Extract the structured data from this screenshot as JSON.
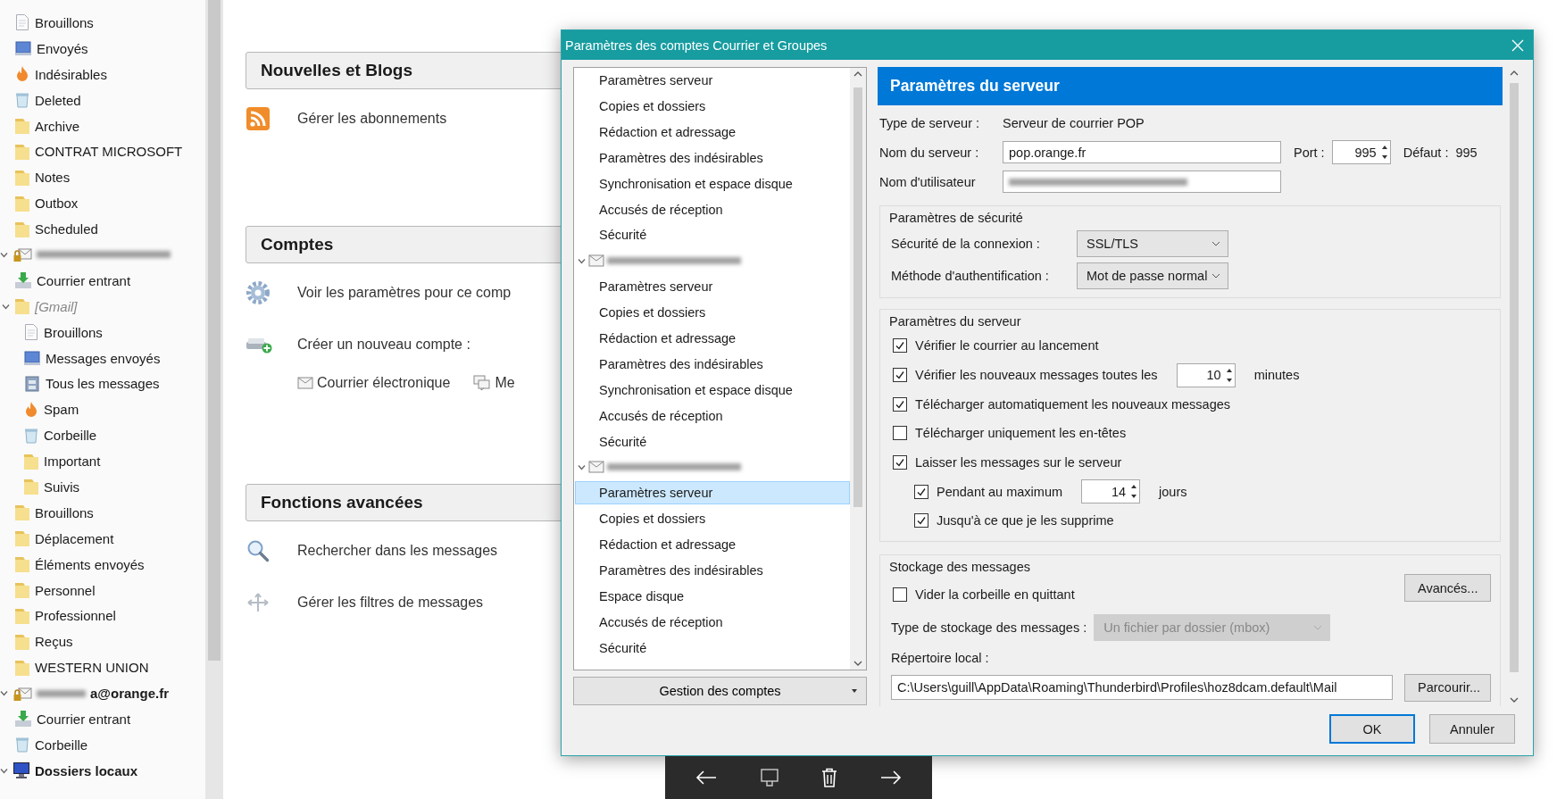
{
  "sidebar": {
    "items": [
      {
        "children": [
          {
            "label": "Brouillons",
            "kind": "drafts"
          },
          {
            "label": "Envoyés",
            "kind": "sent"
          },
          {
            "label": "Indésirables",
            "kind": "junk"
          },
          {
            "label": "Deleted",
            "kind": "trash"
          },
          {
            "label": "Archive",
            "kind": "folder"
          },
          {
            "label": "CONTRAT MICROSOFT",
            "kind": "folder"
          },
          {
            "label": "Notes",
            "kind": "folder"
          },
          {
            "label": "Outbox",
            "kind": "folder"
          },
          {
            "label": "Scheduled",
            "kind": "folder"
          }
        ]
      },
      {
        "kind": "account",
        "redacted": true,
        "expanded": true,
        "children": [
          {
            "label": "Courrier entrant",
            "kind": "inbox"
          },
          {
            "label": "[Gmail]",
            "kind": "virtual",
            "expanded": true,
            "children": [
              {
                "label": "Brouillons",
                "kind": "drafts"
              },
              {
                "label": "Messages envoyés",
                "kind": "sent"
              },
              {
                "label": "Tous les messages",
                "kind": "archive"
              },
              {
                "label": "Spam",
                "kind": "junk"
              },
              {
                "label": "Corbeille",
                "kind": "trash"
              },
              {
                "label": "Important",
                "kind": "folder"
              },
              {
                "label": "Suivis",
                "kind": "folder"
              }
            ]
          },
          {
            "label": "Brouillons",
            "kind": "folder"
          },
          {
            "label": "Déplacement",
            "kind": "folder"
          },
          {
            "label": "Éléments envoyés",
            "kind": "folder"
          },
          {
            "label": "Personnel",
            "kind": "folder"
          },
          {
            "label": "Professionnel",
            "kind": "folder"
          },
          {
            "label": "Reçus",
            "kind": "folder"
          },
          {
            "label": "WESTERN UNION",
            "kind": "folder"
          }
        ]
      },
      {
        "label": "a@orange.fr",
        "kind": "account",
        "redacted": true,
        "expanded": true,
        "children": [
          {
            "label": "Courrier entrant",
            "kind": "inbox"
          },
          {
            "label": "Corbeille",
            "kind": "trash"
          }
        ]
      },
      {
        "label": "Dossiers locaux",
        "kind": "local",
        "redacted": false,
        "expanded": true
      }
    ]
  },
  "main": {
    "sections": [
      {
        "title": "Nouvelles et Blogs",
        "actions": [
          {
            "kind": "rss",
            "label": "Gérer les abonnements"
          }
        ]
      },
      {
        "title": "Comptes",
        "actions": [
          {
            "kind": "gear",
            "label": "Voir les paramètres pour ce comp"
          },
          {
            "kind": "new-account",
            "label": "Créer un nouveau compte :",
            "links": [
              {
                "kind": "envelope",
                "label": "Courrier électronique"
              },
              {
                "kind": "chat",
                "label": "Me"
              }
            ]
          }
        ]
      },
      {
        "title": "Fonctions avancées",
        "actions": [
          {
            "kind": "search",
            "label": "Rechercher dans les messages"
          },
          {
            "kind": "filter",
            "label": "Gérer les filtres de messages"
          }
        ]
      }
    ]
  },
  "dialog": {
    "title": "Paramètres des comptes Courrier et Groupes",
    "tree": [
      {
        "children": [
          {
            "label": "Paramètres serveur",
            "selected": false
          },
          {
            "label": "Copies et dossiers",
            "selected": false
          },
          {
            "label": "Rédaction et adressage",
            "selected": false
          },
          {
            "label": "Paramètres des indésirables",
            "selected": false
          },
          {
            "label": "Synchronisation et espace disque",
            "selected": false
          },
          {
            "label": "Accusés de réception",
            "selected": false
          },
          {
            "label": "Sécurité",
            "selected": false
          }
        ]
      },
      {
        "redacted": true,
        "expanded": true,
        "children": [
          {
            "label": "Paramètres serveur",
            "selected": false
          },
          {
            "label": "Copies et dossiers",
            "selected": false
          },
          {
            "label": "Rédaction et adressage",
            "selected": false
          },
          {
            "label": "Paramètres des indésirables",
            "selected": false
          },
          {
            "label": "Synchronisation et espace disque",
            "selected": false
          },
          {
            "label": "Accusés de réception",
            "selected": false
          },
          {
            "label": "Sécurité",
            "selected": false
          }
        ]
      },
      {
        "redacted": true,
        "expanded": true,
        "children": [
          {
            "label": "Paramètres serveur",
            "selected": true
          },
          {
            "label": "Copies et dossiers",
            "selected": false
          },
          {
            "label": "Rédaction et adressage",
            "selected": false
          },
          {
            "label": "Paramètres des indésirables",
            "selected": false
          },
          {
            "label": "Espace disque",
            "selected": false
          },
          {
            "label": "Accusés de réception",
            "selected": false
          },
          {
            "label": "Sécurité",
            "selected": false
          }
        ]
      }
    ],
    "manage_button": "Gestion des comptes",
    "panel": {
      "title": "Paramètres du serveur",
      "server_type_label": "Type de serveur :",
      "server_type": "Serveur de courrier POP",
      "server_name_label": "Nom du serveur :",
      "server_name": "pop.orange.fr",
      "port_label": "Port :",
      "port": "995",
      "default_label": "Défaut :",
      "default_port": "995",
      "username_label": "Nom d'utilisateur",
      "username_redacted": true,
      "security": {
        "legend": "Paramètres de sécurité",
        "rows": [
          {
            "label": "Sécurité de la connexion :",
            "value": "SSL/TLS"
          },
          {
            "label": "Méthode d'authentification :",
            "value": "Mot de passe normal"
          }
        ]
      },
      "server": {
        "legend": "Paramètres du serveur",
        "options": [
          {
            "kind": "check",
            "label": "Vérifier le courrier au lancement",
            "checked": true
          },
          {
            "kind": "spin",
            "label": "Vérifier les nouveaux messages toutes les",
            "checked": true,
            "value": "10",
            "unit": "minutes"
          },
          {
            "kind": "check",
            "label": "Télécharger automatiquement les nouveaux messages",
            "checked": true
          },
          {
            "kind": "check",
            "label": "Télécharger uniquement les en-têtes",
            "checked": false
          },
          {
            "kind": "check",
            "label": "Laisser les messages sur le serveur",
            "checked": true,
            "children": [
              {
                "kind": "spin",
                "label": "Pendant au maximum",
                "checked": true,
                "value": "14",
                "unit": "jours"
              },
              {
                "kind": "check",
                "label": "Jusqu'à ce que je les supprime",
                "checked": true
              }
            ]
          }
        ]
      },
      "storage": {
        "legend": "Stockage des messages",
        "empty_trash": {
          "label": "Vider la corbeille en quittant",
          "checked": false
        },
        "advanced_button": "Avancés...",
        "type_label": "Type de stockage des messages :",
        "type_value": "Un fichier par dossier (mbox)",
        "type_disabled": true,
        "local_dir_label": "Répertoire local :",
        "local_dir": "C:\\Users\\guill\\AppData\\Roaming\\Thunderbird\\Profiles\\hoz8dcam.default\\Mail",
        "browse_button": "Parcourir..."
      }
    },
    "buttons": [
      {
        "label": "OK",
        "default": true
      },
      {
        "label": "Annuler",
        "default": false
      }
    ]
  }
}
